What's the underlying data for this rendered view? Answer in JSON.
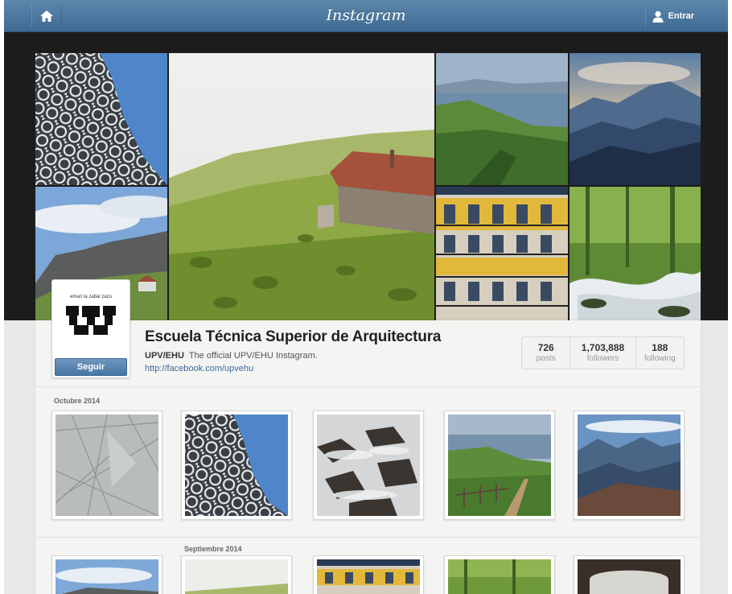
{
  "header": {
    "logo": "Instagram",
    "login_label": "Entrar",
    "home_icon": "home-icon",
    "user_icon": "user-icon"
  },
  "profile": {
    "name": "Escuela Técnica Superior de Arquitectura",
    "username": "UPV/EHU",
    "bio": "The official UPV/EHU Instagram.",
    "link": "http://facebook.com/upvehu",
    "follow_label": "Seguir",
    "avatar_motto": "eman ta zabal zazu"
  },
  "stats": [
    {
      "value": "726",
      "label": "posts"
    },
    {
      "value": "1,703,888",
      "label": "followers"
    },
    {
      "value": "188",
      "label": "following"
    }
  ],
  "sections": [
    {
      "month": "Octubre 2014"
    },
    {
      "month": "Septiembre 2014"
    }
  ],
  "colors": {
    "topbar": "#4a77a0",
    "accent_link": "#3b6a98",
    "follow_button": "#4777a4"
  }
}
